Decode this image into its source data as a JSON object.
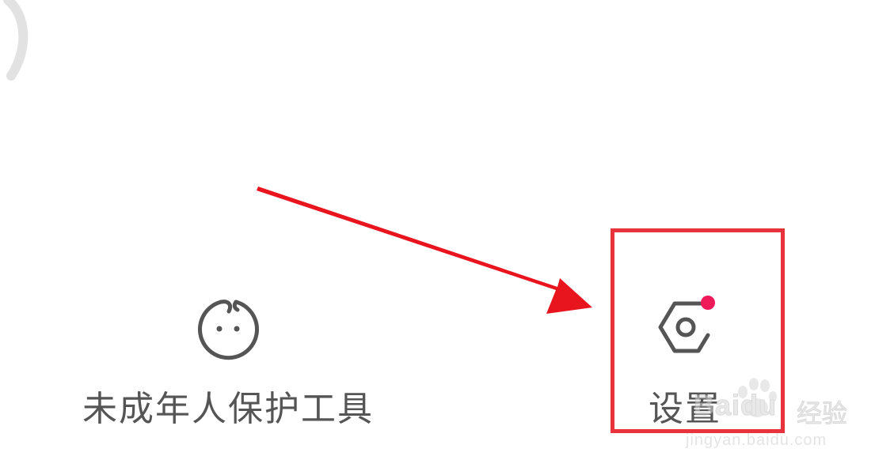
{
  "menu": {
    "minor_protection": {
      "label": "未成年人保护工具",
      "icon": "baby-face-icon"
    },
    "settings": {
      "label": "设置",
      "icon": "settings-gear-icon",
      "has_notification_dot": true
    }
  },
  "annotation": {
    "arrow_color": "#e8151f",
    "highlight_color": "#e8323c"
  },
  "watermark": {
    "brand_text": "Baidu",
    "product_text": "经验",
    "url_text": "jingyan.baidu.com"
  },
  "colors": {
    "icon_gray": "#555555",
    "notification_dot": "#f0195a"
  }
}
